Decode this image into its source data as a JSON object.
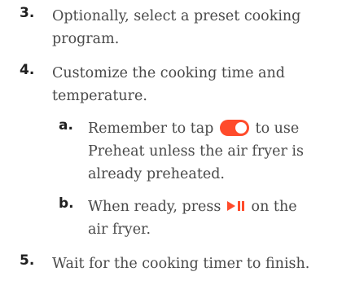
{
  "steps": [
    {
      "number": "3.",
      "line1": "Optionally, select a preset cooking",
      "line2": "program."
    },
    {
      "number": "4.",
      "line1": "Customize the cooking time and",
      "line2": "temperature."
    },
    {
      "number": "5.",
      "line1": "Wait for the cooking timer to finish."
    }
  ],
  "substeps": [
    {
      "letter": "a.",
      "pre": "Remember to tap",
      "post": "to use",
      "line2": "Preheat unless the air fryer is",
      "line3": "already preheated."
    },
    {
      "letter": "b.",
      "pre": "When ready, press",
      "post": "on the",
      "line2": "air fryer."
    }
  ],
  "icons": {
    "toggle": "toggle-icon",
    "play_pause": "play-pause-icon"
  },
  "colors": {
    "accent": "#ff4b2b",
    "number": "#1f1f1f",
    "text": "#4a4a4a"
  }
}
